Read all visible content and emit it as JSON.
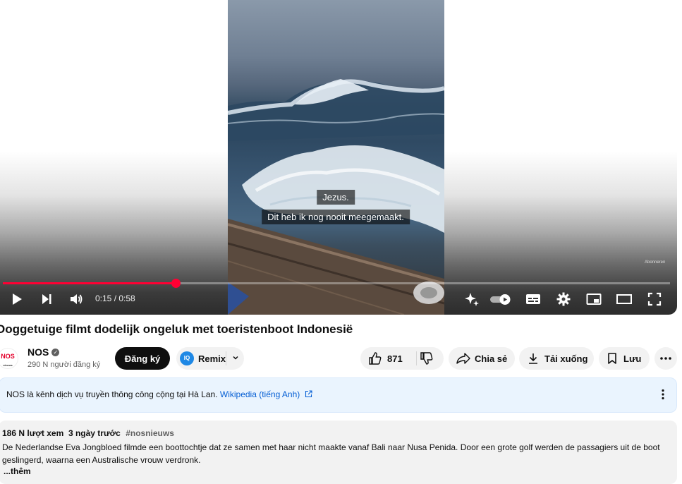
{
  "player": {
    "subtitle_line1": "Jezus.",
    "subtitle_line2": "Dit heb ik nog nooit meegemaakt.",
    "watermark": "Abonneren",
    "time_display": "0:15 / 0:58",
    "progress": 0.259,
    "accent_color": "#ff0033",
    "controls": [
      "play-icon",
      "next-icon",
      "volume-icon",
      "sparkle-icon",
      "autoplay-toggle-icon",
      "subtitles-icon",
      "gear-icon",
      "miniplayer-icon",
      "theater-icon",
      "fullscreen-icon"
    ]
  },
  "video": {
    "title": "Ooggetuige filmt dodelijk ongeluk met toeristenboot Indonesië"
  },
  "channel": {
    "logo_text": "NOS",
    "logo_sub": "nieuws",
    "name": "NOS",
    "subscribers": "290 N người đăng ký",
    "subscribe_label": "Đăng ký"
  },
  "actions": {
    "remix_badge": "IQ",
    "remix_label": "Remix",
    "like_count": "871",
    "share_label": "Chia sẻ",
    "download_label": "Tải xuống",
    "save_label": "Lưu"
  },
  "info_panel": {
    "text": "NOS là kênh dịch vụ truyền thông công cộng tại Hà Lan.",
    "link_label": "Wikipedia (tiếng Anh)"
  },
  "description": {
    "views": "186 N lượt xem",
    "date": "3 ngày trước",
    "hashtag": "#nosnieuws",
    "text": "De Nederlandse Eva Jongbloed filmde een boottochtje dat ze samen met haar nicht maakte vanaf Bali naar Nusa Penida. Door een grote golf werden de passagiers uit de boot geslingerd, waarna een Australische vrouw verdronk.",
    "more_label": "...thêm"
  }
}
